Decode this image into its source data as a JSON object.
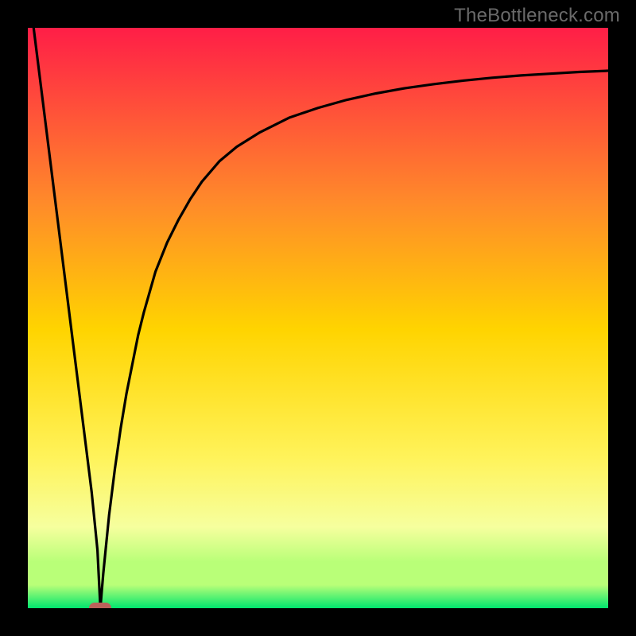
{
  "watermark": "TheBottleneck.com",
  "chart_data": {
    "type": "line",
    "title": "",
    "xlabel": "",
    "ylabel": "",
    "xlim": [
      0,
      100
    ],
    "ylim": [
      0,
      100
    ],
    "gradient_colors": {
      "top": "#ff1e47",
      "upper_mid": "#ff8a2a",
      "mid": "#ffd400",
      "lower_mid": "#fff35a",
      "bottom_band": "#f6ff9e",
      "near_bottom": "#b9ff78",
      "bottom": "#00e56e"
    },
    "gradient_stops_vertical_pct": [
      0,
      30,
      52,
      74,
      86,
      92,
      96,
      100
    ],
    "series": [
      {
        "name": "bottleneck-curve",
        "color": "#000000",
        "x": [
          0,
          1,
          2,
          3,
          4,
          5,
          6,
          7,
          8,
          9,
          10,
          11,
          12,
          12.5,
          13,
          14,
          15,
          16,
          17,
          18,
          19,
          20,
          22,
          24,
          26,
          28,
          30,
          33,
          36,
          40,
          45,
          50,
          55,
          60,
          65,
          70,
          75,
          80,
          85,
          90,
          95,
          100
        ],
        "y": [
          108,
          100,
          92,
          84,
          76,
          68,
          60,
          52,
          44,
          36,
          28,
          20,
          10,
          0,
          6,
          16,
          24,
          31,
          37,
          42,
          47,
          51,
          58,
          63,
          67,
          70.5,
          73.5,
          77,
          79.5,
          82,
          84.5,
          86.2,
          87.6,
          88.7,
          89.6,
          90.3,
          90.9,
          91.4,
          91.8,
          92.1,
          92.4,
          92.6
        ]
      }
    ],
    "min_marker": {
      "x": 12.5,
      "y": 0,
      "color": "#bb615a"
    }
  }
}
